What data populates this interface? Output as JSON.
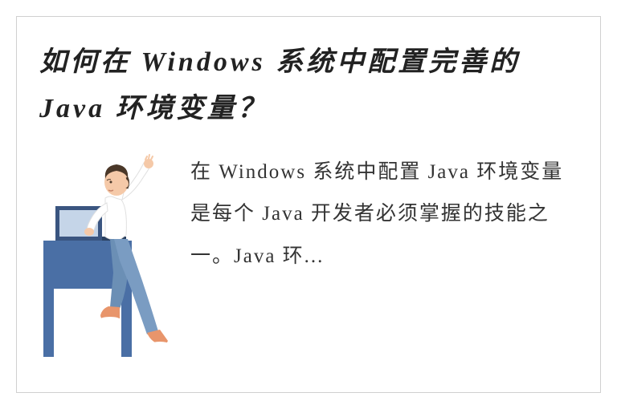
{
  "title": "如何在 Windows 系统中配置完善的 Java 环境变量？",
  "body": "在 Windows 系统中配置 Java 环境变量是每个 Java 开发者必须掌握的技能之一。Java 环...",
  "colors": {
    "skin": "#f5c9a8",
    "hair": "#4a3728",
    "shirt": "#ffffff",
    "pants": "#6b8fb5",
    "shoes": "#e8956b",
    "desk": "#4a6fa5",
    "laptop": "#3a5580",
    "screen": "#c5d5e8"
  }
}
